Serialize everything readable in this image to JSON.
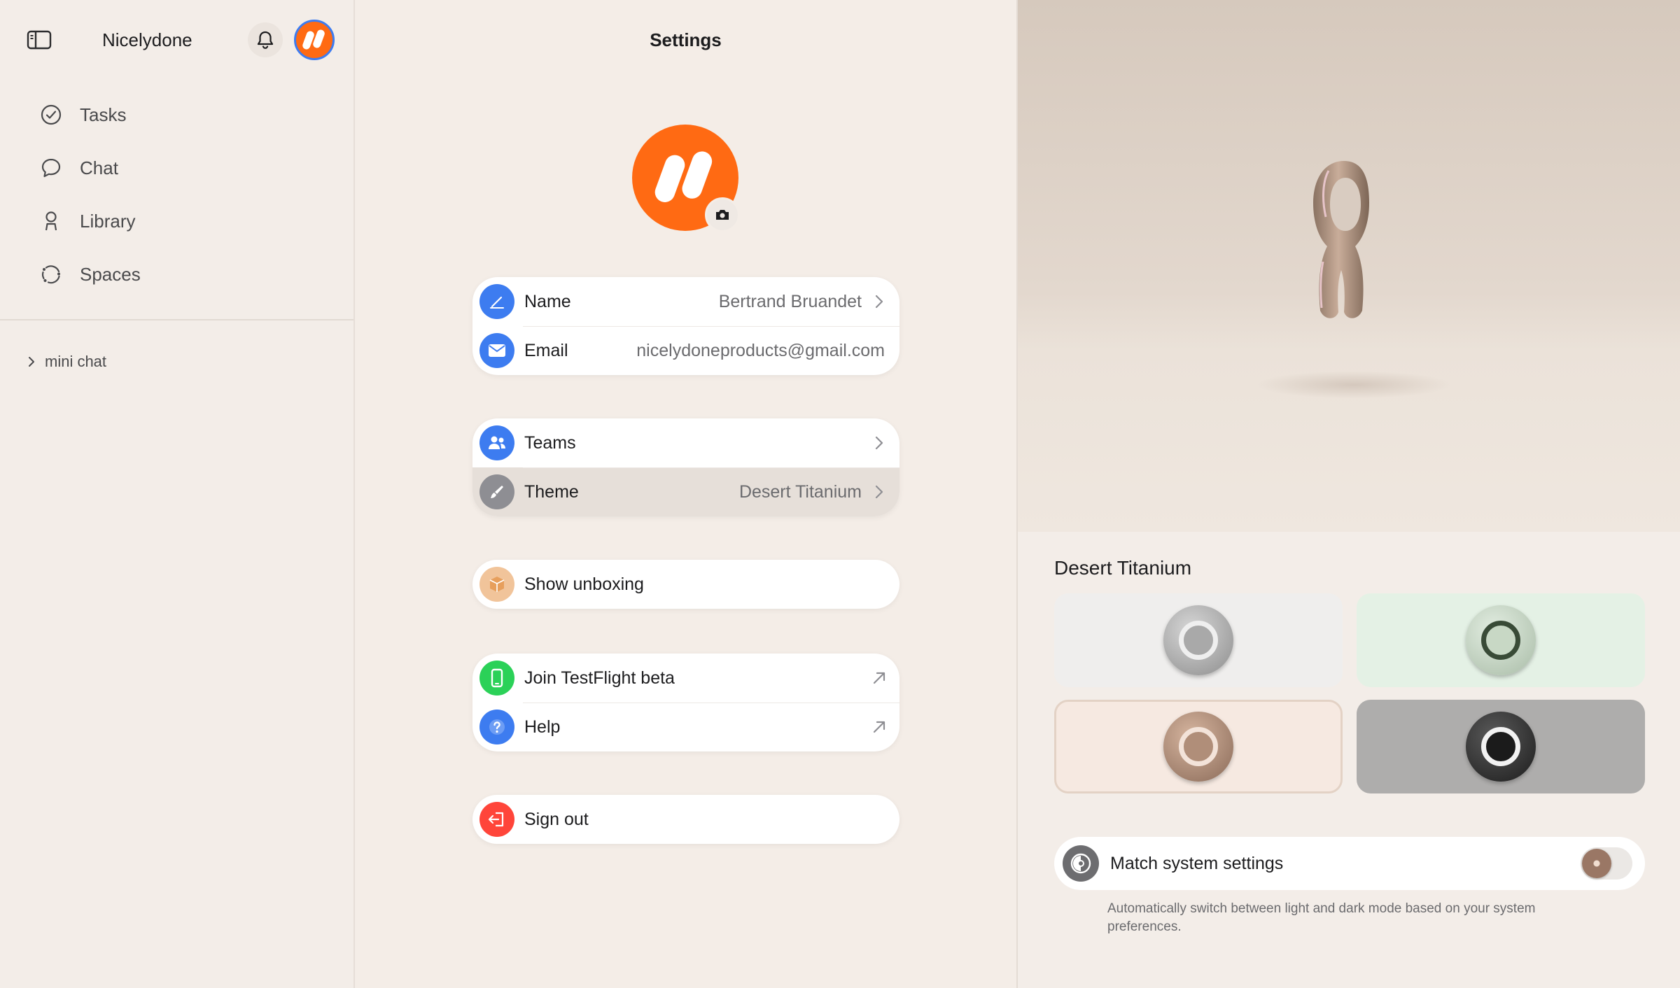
{
  "sidebar": {
    "app_name": "Nicelydone",
    "nav": [
      {
        "label": "Tasks",
        "icon": "check-circle-icon"
      },
      {
        "label": "Chat",
        "icon": "chat-bubble-icon"
      },
      {
        "label": "Library",
        "icon": "person-icon"
      },
      {
        "label": "Spaces",
        "icon": "spaces-icon"
      }
    ],
    "mini_chat": "mini chat"
  },
  "settings": {
    "title": "Settings",
    "profile": {
      "name_label": "Name",
      "name_value": "Bertrand Bruandet",
      "email_label": "Email",
      "email_value": "nicelydoneproducts@gmail.com"
    },
    "teams_label": "Teams",
    "theme_label": "Theme",
    "theme_value": "Desert Titanium",
    "unboxing_label": "Show unboxing",
    "testflight_label": "Join TestFlight beta",
    "help_label": "Help",
    "signout_label": "Sign out"
  },
  "theme_panel": {
    "selected_theme": "Desert Titanium",
    "options": [
      "silver",
      "green",
      "desert",
      "black"
    ],
    "match_label": "Match system settings",
    "match_enabled": false,
    "match_description": "Automatically switch between light and dark mode based on your system preferences."
  },
  "colors": {
    "brand_orange": "#ff6a13",
    "accent_blue": "#3d7cf0",
    "green": "#34c759",
    "red": "#ff453a"
  }
}
